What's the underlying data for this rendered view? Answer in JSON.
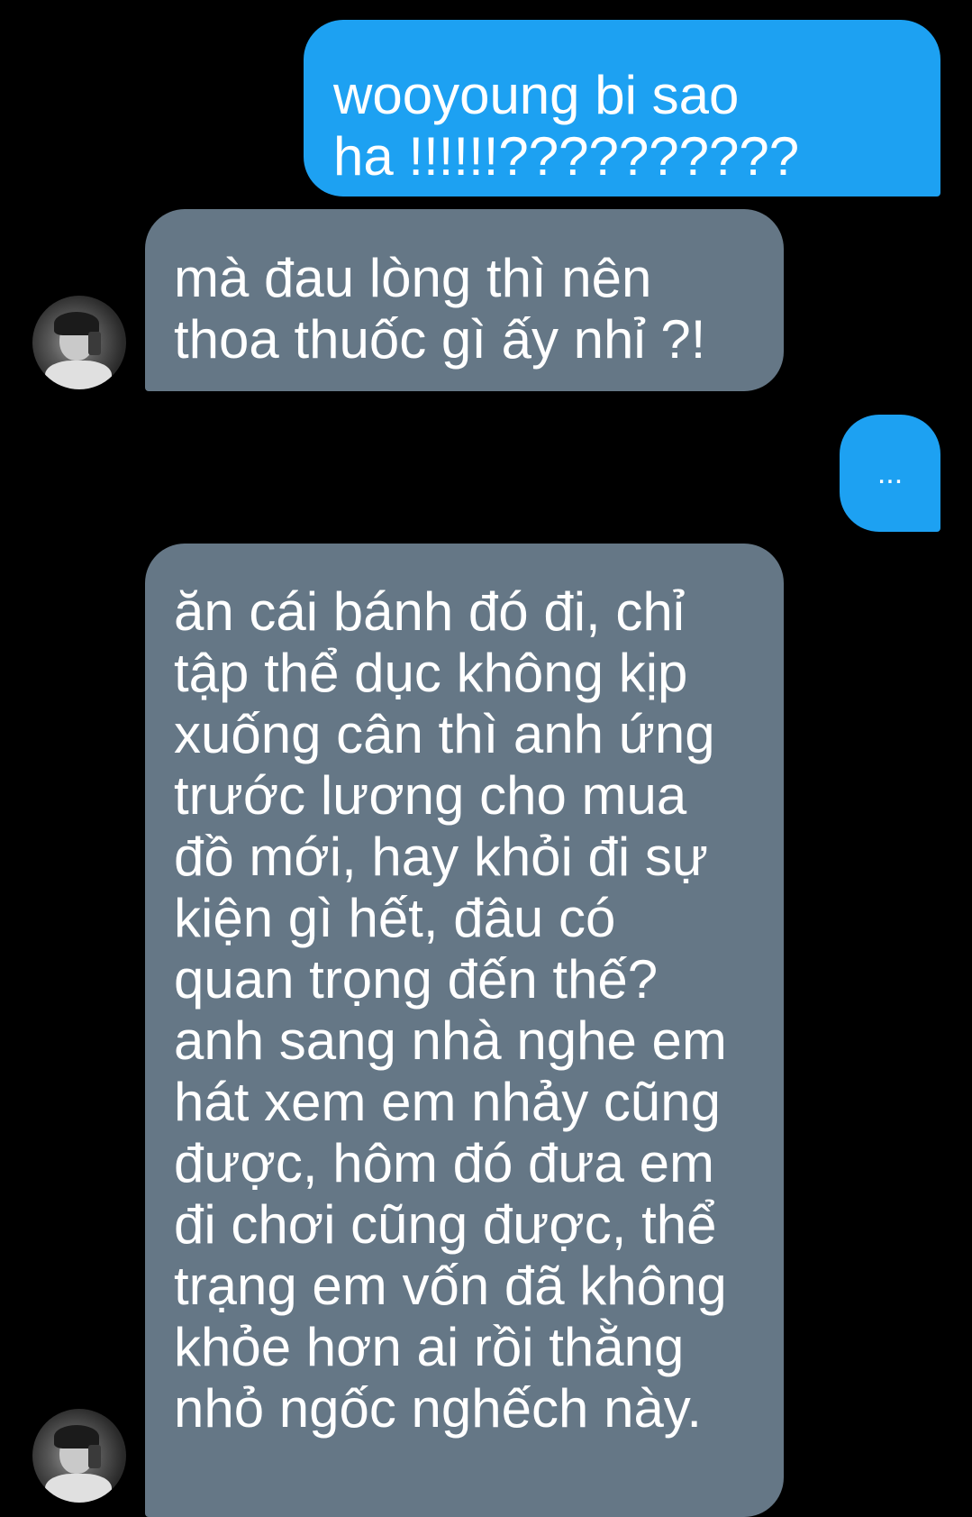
{
  "messages": [
    {
      "id": "msg1",
      "direction": "sent",
      "text": "wooyoung bi sao\nha !!!!!!??????????"
    },
    {
      "id": "msg2",
      "direction": "received",
      "text": "mà đau lòng thì nên\nthoa thuốc gì ấy nhỉ ?!"
    },
    {
      "id": "msg3",
      "direction": "sent",
      "text": "..."
    },
    {
      "id": "msg4",
      "direction": "received",
      "text": "ăn cái bánh đó đi, chỉ\ntập thể dục không kịp\nxuống cân thì anh ứng\ntrước lương cho mua\nđồ mới, hay khỏi đi sự\nkiện gì hết, đâu có\nquan trọng đến thế?\nanh sang nhà nghe em\nhát xem em nhảy cũng\nđược, hôm đó đưa em\nđi chơi cũng được, thể\ntrạng em vốn đã không\nkhỏe hơn ai rồi thằng\nnhỏ ngốc nghếch này."
    }
  ],
  "colors": {
    "background": "#000000",
    "sent_bubble": "#1da1f2",
    "received_bubble": "#657786",
    "text": "#ffffff"
  },
  "avatars": [
    {
      "icon": "avatar-photo-icon"
    },
    {
      "icon": "avatar-photo-icon"
    }
  ]
}
